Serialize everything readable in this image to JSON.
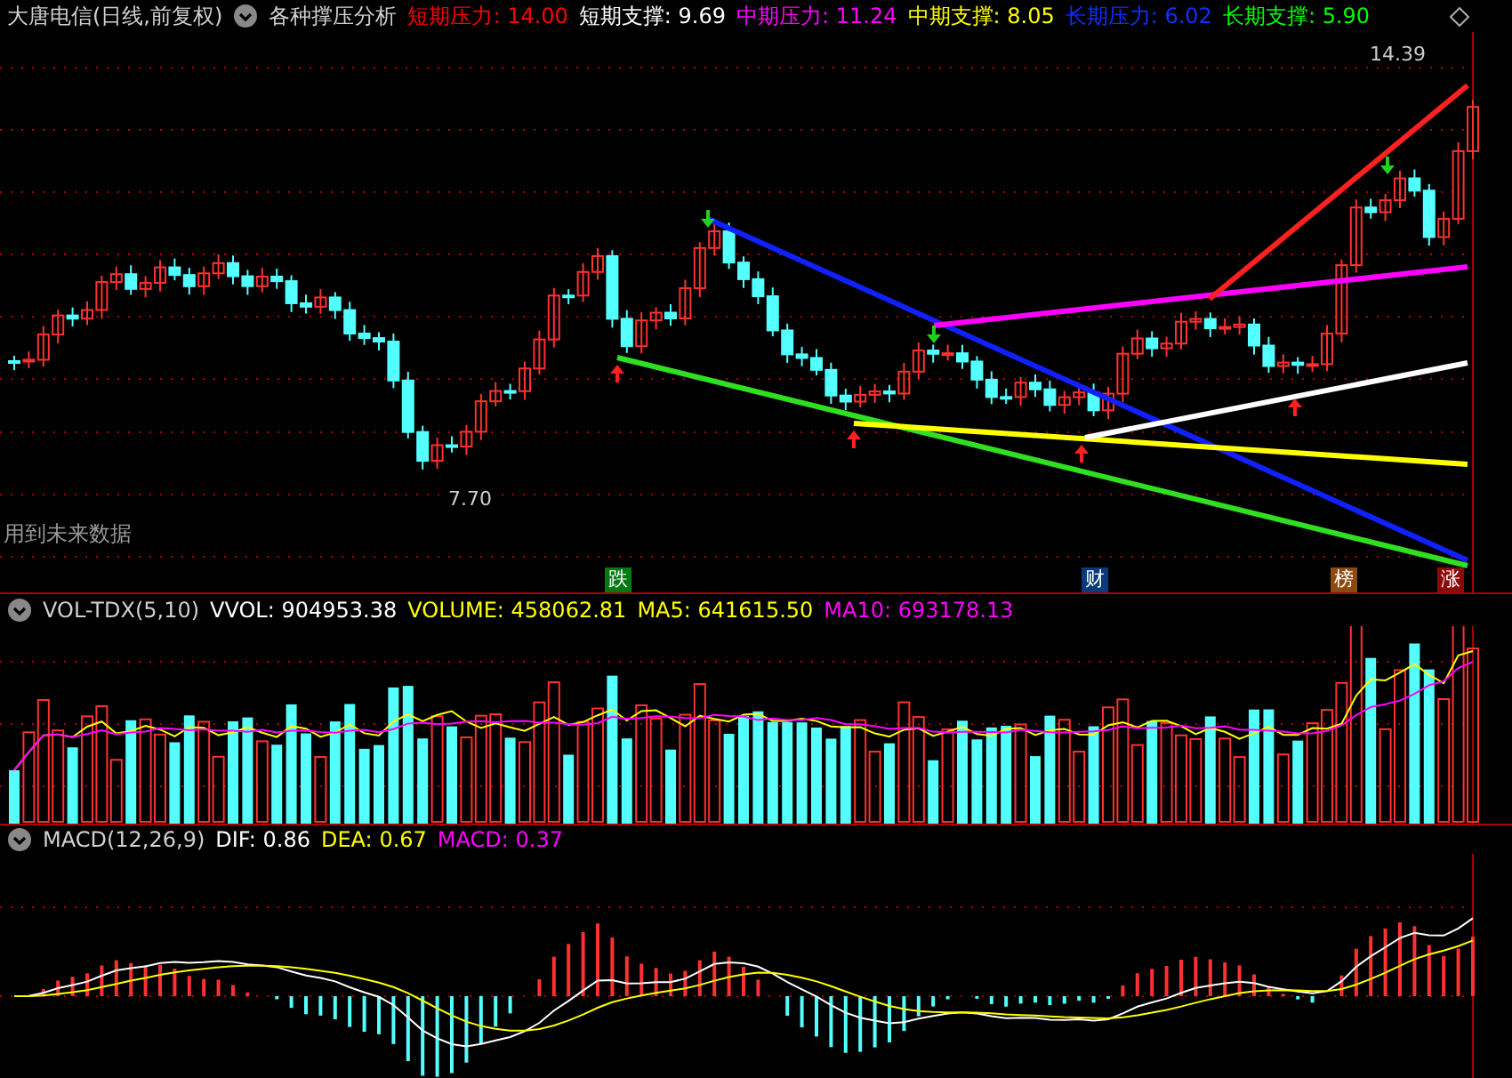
{
  "title": {
    "stock": "大唐电信",
    "period": "(日线,前复权)",
    "indicator": "各种撑压分析"
  },
  "levels": [
    {
      "label": "短期压力:",
      "value": "14.00",
      "color": "#ff0000"
    },
    {
      "label": "短期支撑:",
      "value": "9.69",
      "color": "#ffffff"
    },
    {
      "label": "中期压力:",
      "value": "11.24",
      "color": "#ff00ff"
    },
    {
      "label": "中期支撑:",
      "value": "8.05",
      "color": "#ffff00"
    },
    {
      "label": "长期压力:",
      "value": "6.02",
      "color": "#1030ff"
    },
    {
      "label": "长期支撑:",
      "value": "5.90",
      "color": "#00ff00"
    }
  ],
  "main_chart": {
    "high_label": "14.39",
    "low_label": "7.70",
    "note": "用到未来数据",
    "events": [
      {
        "text": "跌",
        "color": "#007a10"
      },
      {
        "text": "财",
        "color": "#0a3a7a"
      },
      {
        "text": "榜",
        "color": "#8a4a10"
      },
      {
        "text": "涨",
        "color": "#8a0a0a"
      }
    ]
  },
  "volume": {
    "name": "VOL-TDX(5,10)",
    "items": [
      {
        "label": "VVOL:",
        "value": "904953.38",
        "color": "#ffffff"
      },
      {
        "label": "VOLUME:",
        "value": "458062.81",
        "color": "#ffff00"
      },
      {
        "label": "MA5:",
        "value": "641615.50",
        "color": "#ffff00"
      },
      {
        "label": "MA10:",
        "value": "693178.13",
        "color": "#ff00ff"
      }
    ]
  },
  "macd": {
    "name": "MACD(12,26,9)",
    "items": [
      {
        "label": "DIF:",
        "value": "0.86",
        "color": "#ffffff"
      },
      {
        "label": "DEA:",
        "value": "0.67",
        "color": "#ffff00"
      },
      {
        "label": "MACD:",
        "value": "0.37",
        "color": "#ff00ff"
      }
    ]
  }
}
